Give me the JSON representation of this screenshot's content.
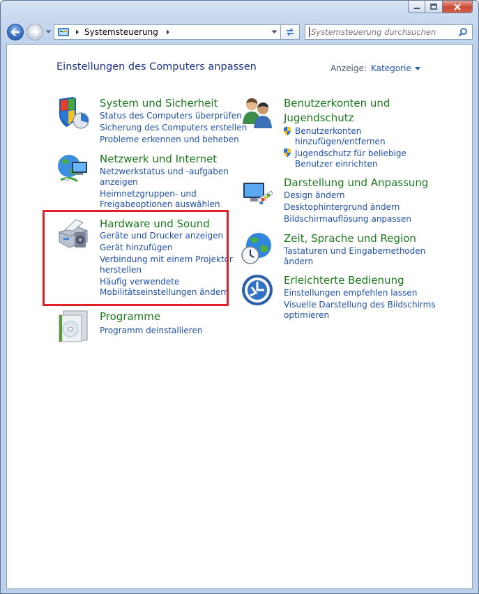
{
  "window": {
    "controls": {
      "minimize": "minimize",
      "maximize": "maximize",
      "close": "close"
    }
  },
  "toolbar": {
    "breadcrumb": "Systemsteuerung",
    "search_placeholder": "Systemsteuerung durchsuchen"
  },
  "header": {
    "title": "Einstellungen des Computers anpassen",
    "view_label": "Anzeige:",
    "view_value": "Kategorie"
  },
  "categories": {
    "system": {
      "title": "System und Sicherheit",
      "links": [
        "Status des Computers überprüfen",
        "Sicherung des Computers erstellen",
        "Probleme erkennen und beheben"
      ]
    },
    "network": {
      "title": "Netzwerk und Internet",
      "links": [
        "Netzwerkstatus und -aufgaben",
        "anzeigen",
        "Heimnetzgruppen- und",
        "Freigabeoptionen auswählen"
      ]
    },
    "hardware": {
      "title": "Hardware und Sound",
      "links": [
        "Geräte und Drucker anzeigen",
        "Gerät hinzufügen",
        "Verbindung mit einem Projektor",
        "herstellen",
        "Häufig verwendete",
        "Mobilitätseinstellungen ändern"
      ]
    },
    "programs": {
      "title": "Programme",
      "links": [
        "Programm deinstallieren"
      ]
    },
    "accounts": {
      "title_line1": "Benutzerkonten und",
      "title_line2": "Jugendschutz",
      "links": [
        "Benutzerkonten",
        "hinzufügen/entfernen",
        "Jugendschutz für beliebige",
        "Benutzer einrichten"
      ]
    },
    "appearance": {
      "title": "Darstellung und Anpassung",
      "links": [
        "Design ändern",
        "Desktophintergrund ändern",
        "Bildschirmauflösung anpassen"
      ]
    },
    "clock": {
      "title": "Zeit, Sprache und Region",
      "links": [
        "Tastaturen und Eingabemethoden",
        "ändern"
      ]
    },
    "access": {
      "title": "Erleichterte Bedienung",
      "links": [
        "Einstellungen empfehlen lassen",
        "Visuelle Darstellung des Bildschirms",
        "optimieren"
      ]
    }
  },
  "colors": {
    "highlight": "#e01f27",
    "title_green": "#1c7a1c",
    "link_blue": "#1e50a8"
  }
}
